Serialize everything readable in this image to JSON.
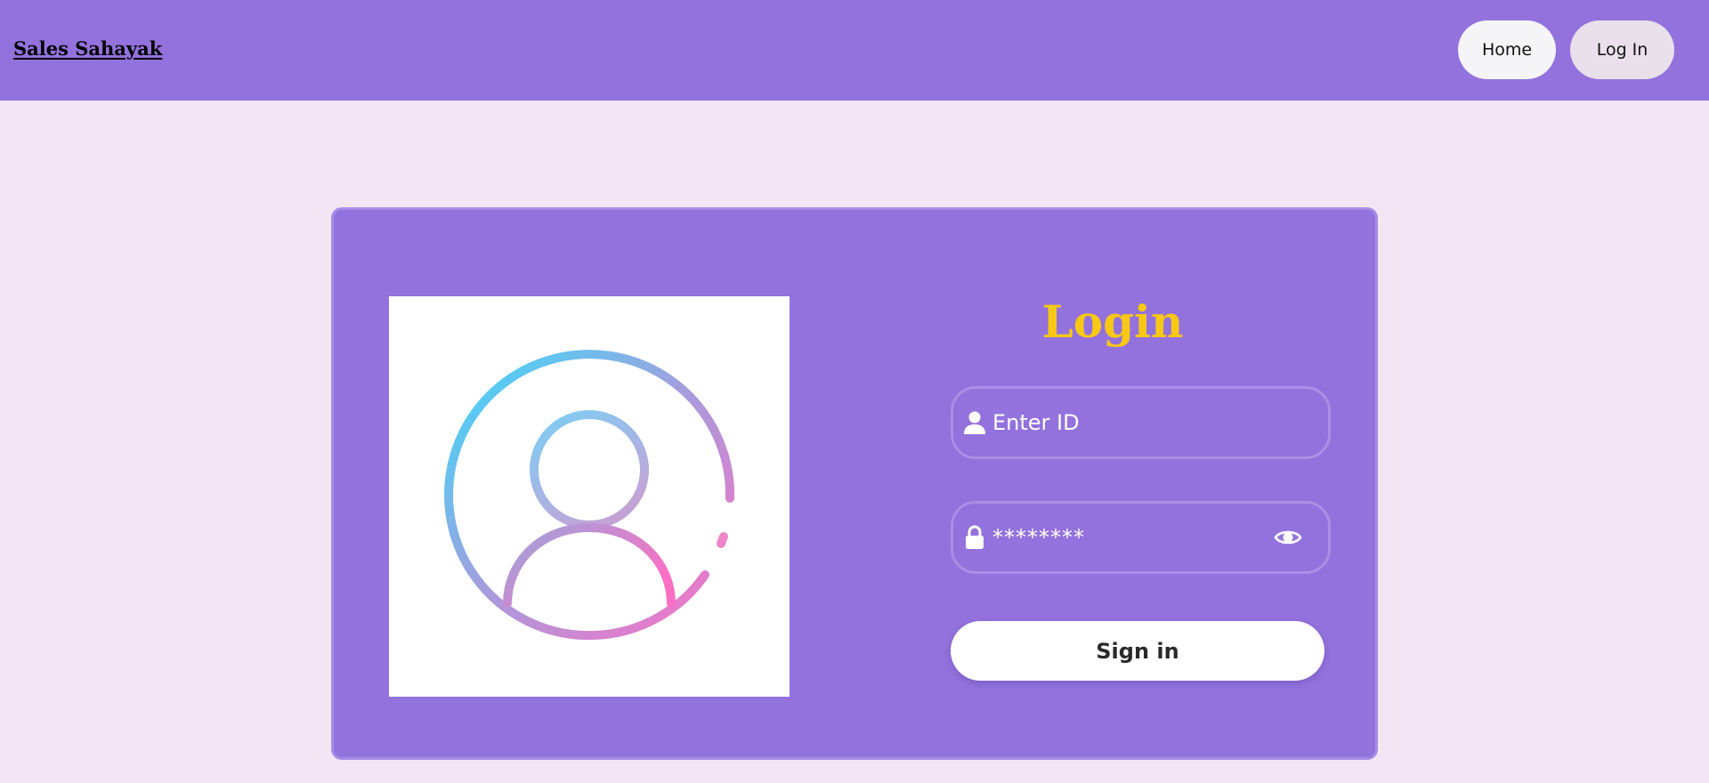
{
  "navbar": {
    "brand": "Sales Sahayak",
    "home_label": "Home",
    "login_label": "Log In",
    "background": "#9372dd"
  },
  "card": {
    "avatar_icon": "user-circle-gradient",
    "title": "Login",
    "title_color": "#f7c815",
    "id_field": {
      "placeholder": "Enter ID",
      "value": "",
      "icon": "user-icon"
    },
    "password_field": {
      "value": "********",
      "icon": "lock-icon",
      "toggle_icon": "eye-icon"
    },
    "signin_label": "Sign in"
  },
  "colors": {
    "page_background": "#f2e6f5",
    "accent": "#9372dd",
    "gradient_start": "#3adcfb",
    "gradient_end": "#fb6fc4"
  }
}
